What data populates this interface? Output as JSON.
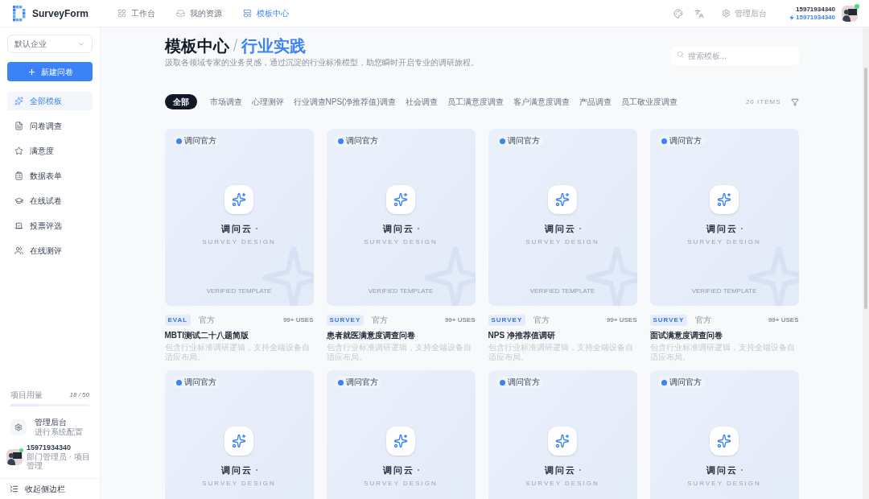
{
  "header": {
    "logo_text": "SurveyForm",
    "nav": [
      {
        "label": "工作台",
        "selected": false
      },
      {
        "label": "我的资源",
        "selected": false
      },
      {
        "label": "模板中心",
        "selected": true
      }
    ],
    "admin_label": "管理后台",
    "user": {
      "name": "15971934340",
      "sub": "15971934340"
    }
  },
  "sidebar": {
    "org_select": {
      "value": "默认企业"
    },
    "new_button": "新建问卷",
    "items": [
      {
        "label": "全部模板",
        "selected": true
      },
      {
        "label": "问卷调查",
        "selected": false
      },
      {
        "label": "满意度",
        "selected": false
      },
      {
        "label": "数据表单",
        "selected": false
      },
      {
        "label": "在线试卷",
        "selected": false
      },
      {
        "label": "投票评选",
        "selected": false
      },
      {
        "label": "在线测评",
        "selected": false
      }
    ],
    "usage": {
      "label": "项目用量",
      "count": "18 / 50",
      "level": 0.36
    },
    "admin": {
      "title": "管理后台",
      "subtitle": "进行系统配置"
    },
    "user": {
      "name": "15971934340",
      "role": "部门管理员 · 项目管理"
    },
    "collapse_label": "收起侧边栏"
  },
  "main": {
    "title": "模板中心",
    "title_accent": "行业实践",
    "subtitle": "汲取各领域专家的业务灵感，通过沉淀的行业标准模型，助您瞬时开启专业的调研旅程。",
    "search": {
      "placeholder": "搜索模板..."
    },
    "tabs": [
      {
        "label": "全部",
        "selected": true
      },
      {
        "label": "市场调查",
        "selected": false
      },
      {
        "label": "心理测评",
        "selected": false
      },
      {
        "label": "行业调查NPS(净推荐值)调查",
        "selected": false
      },
      {
        "label": "社会调查",
        "selected": false
      },
      {
        "label": "员工满意度调查",
        "selected": false
      },
      {
        "label": "客户满意度调查",
        "selected": false
      },
      {
        "label": "产品调查",
        "selected": false
      },
      {
        "label": "员工敬业度调查",
        "selected": false
      }
    ],
    "item_count": "20 ITEMS",
    "cards": [
      {
        "badge": "调问官方",
        "brand": "调问云",
        "brand_sub": "SURVEY DESIGN",
        "verified": "VERIFIED TEMPLATE",
        "tag": "EVAL",
        "source": "官方",
        "uses": "99+ USES",
        "title": "MBTI测试二十八题简版",
        "description": "包含行业标准调研逻辑，支持全端设备自适应布局。"
      },
      {
        "badge": "调问官方",
        "brand": "调问云",
        "brand_sub": "SURVEY DESIGN",
        "verified": "VERIFIED TEMPLATE",
        "tag": "SURVEY",
        "source": "官方",
        "uses": "99+ USES",
        "title": "患者就医满意度调查问卷",
        "description": "包含行业标准调研逻辑，支持全端设备自适应布局。"
      },
      {
        "badge": "调问官方",
        "brand": "调问云",
        "brand_sub": "SURVEY DESIGN",
        "verified": "VERIFIED TEMPLATE",
        "tag": "SURVEY",
        "source": "官方",
        "uses": "99+ USES",
        "title": "NPS 净推荐值调研",
        "description": "包含行业标准调研逻辑，支持全端设备自适应布局。"
      },
      {
        "badge": "调问官方",
        "brand": "调问云",
        "brand_sub": "SURVEY DESIGN",
        "verified": "VERIFIED TEMPLATE",
        "tag": "SURVEY",
        "source": "官方",
        "uses": "99+ USES",
        "title": "面试满意度调查问卷",
        "description": "包含行业标准调研逻辑，支持全端设备自适应布局。"
      },
      {
        "badge": "调问官方",
        "brand": "调问云",
        "brand_sub": "SURVEY DESIGN"
      },
      {
        "badge": "调问官方",
        "brand": "调问云",
        "brand_sub": "SURVEY DESIGN"
      },
      {
        "badge": "调问官方",
        "brand": "调问云",
        "brand_sub": "SURVEY DESIGN"
      },
      {
        "badge": "调问官方",
        "brand": "调问云",
        "brand_sub": "SURVEY DESIGN"
      }
    ]
  }
}
